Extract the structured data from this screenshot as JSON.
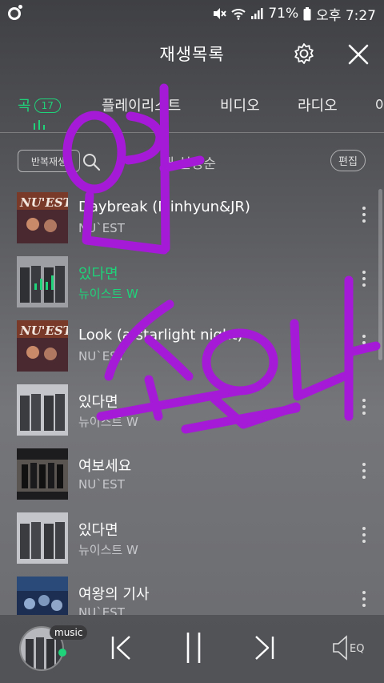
{
  "status_bar": {
    "battery": "71%",
    "time": "오후 7:27"
  },
  "header": {
    "title": "재생목록"
  },
  "tabs": [
    {
      "label": "곡",
      "badge": "17",
      "active": true
    },
    {
      "label": "플레이리스트",
      "active": false
    },
    {
      "label": "비디오",
      "active": false
    },
    {
      "label": "라디오",
      "active": false
    },
    {
      "label": "아",
      "active": false
    }
  ],
  "toolbar": {
    "repeat_label": "반복재생",
    "sort_label": "내 설정순",
    "edit_label": "편집"
  },
  "songs": [
    {
      "title": "Daybreak (Minhyun&JR)",
      "artist": "NU`EST",
      "playing": false,
      "art": "nuest"
    },
    {
      "title": "있다면",
      "artist": "뉴이스트 W",
      "playing": true,
      "art": "w"
    },
    {
      "title": "Look (a starlight night)",
      "artist": "NU`EST",
      "playing": false,
      "art": "nuest"
    },
    {
      "title": "있다면",
      "artist": "뉴이스트 W",
      "playing": false,
      "art": "w"
    },
    {
      "title": "여보세요",
      "artist": "NU`EST",
      "playing": false,
      "art": "group"
    },
    {
      "title": "있다면",
      "artist": "뉴이스트 W",
      "playing": false,
      "art": "w"
    },
    {
      "title": "여왕의 기사",
      "artist": "NU`EST",
      "playing": false,
      "art": "blue"
    }
  ],
  "player": {
    "tag": "music",
    "eq_label": "EQ"
  },
  "overlay_text": "와 소오다",
  "colors": {
    "accent": "#1fd37a",
    "scribble": "#a41ad6"
  }
}
